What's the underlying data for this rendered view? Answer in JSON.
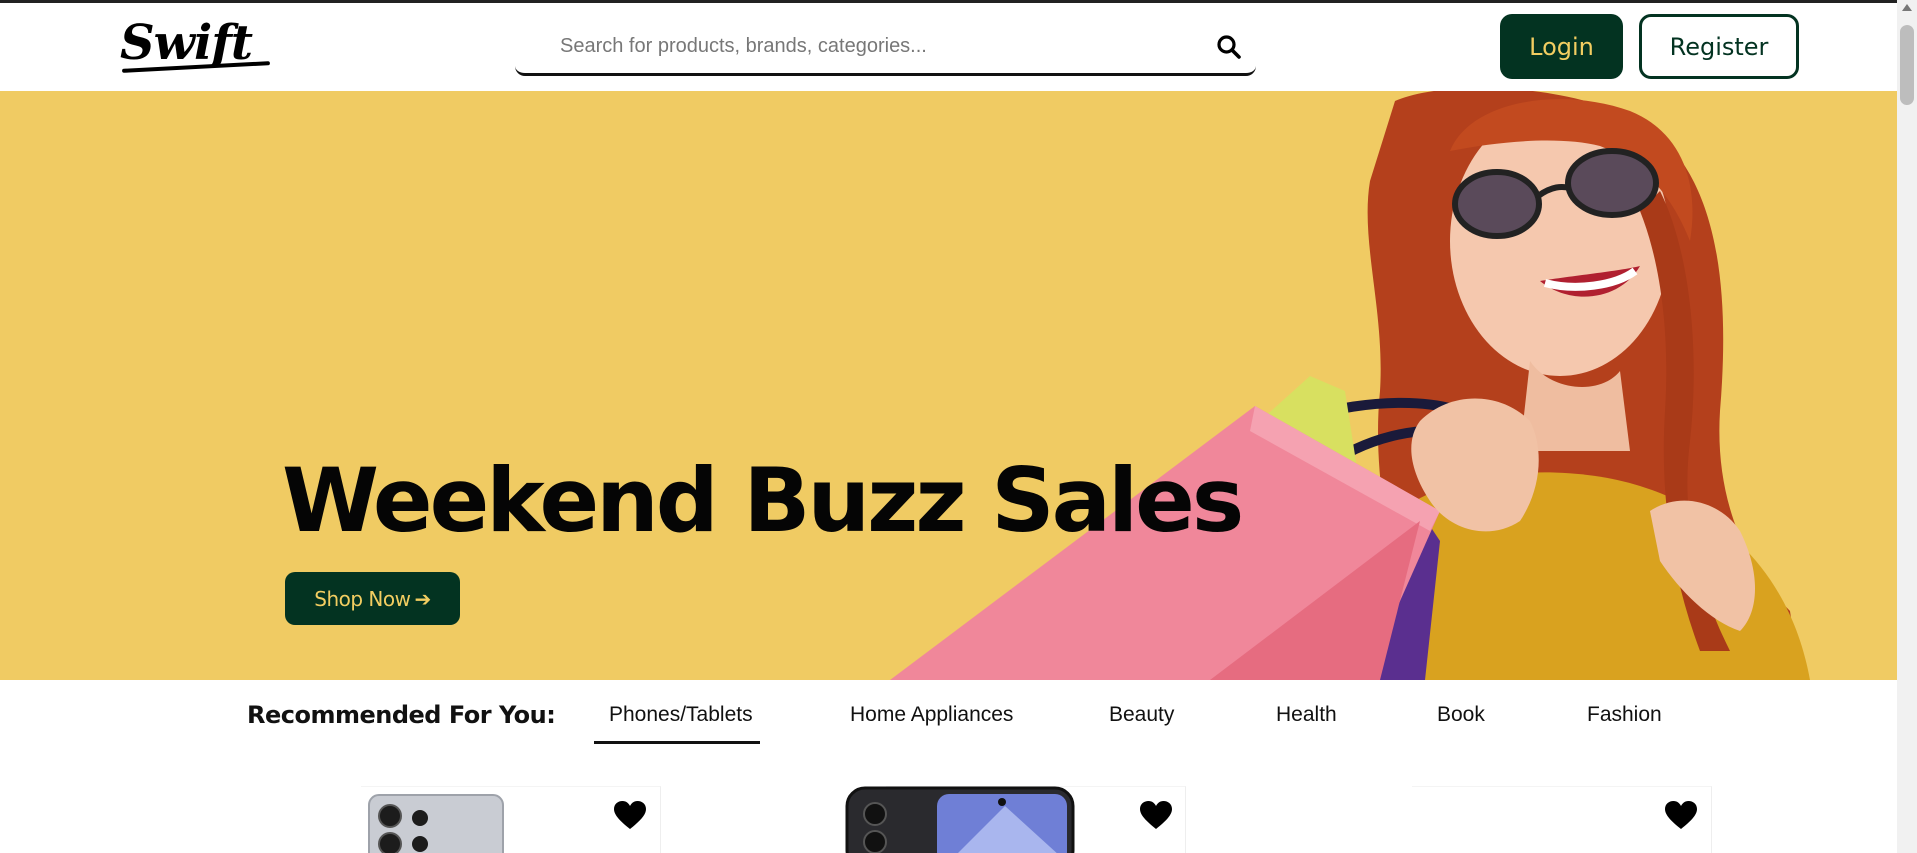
{
  "brand": {
    "logo_text": "Swift"
  },
  "search": {
    "placeholder": "Search for products, brands, categories..."
  },
  "auth": {
    "login_label": "Login",
    "register_label": "Register"
  },
  "hero": {
    "title": "Weekend Buzz Sales",
    "cta_label": "Shop Now",
    "cta_icon": "arrow-right-icon",
    "background_color": "#f0cb63"
  },
  "recommended": {
    "heading": "Recommended For You:",
    "tabs": [
      {
        "label": "Phones/Tablets",
        "active": true
      },
      {
        "label": "Home Appliances",
        "active": false
      },
      {
        "label": "Beauty",
        "active": false
      },
      {
        "label": "Health",
        "active": false
      },
      {
        "label": "Book",
        "active": false
      },
      {
        "label": "Fashion",
        "active": false
      }
    ]
  },
  "products": [
    {
      "image": "silver-phone",
      "wishlist_icon": "heart-icon"
    },
    {
      "image": "dark-phone",
      "wishlist_icon": "heart-icon"
    },
    {
      "image": "",
      "wishlist_icon": "heart-icon"
    }
  ],
  "colors": {
    "primary": "#033321",
    "accent": "#f2cd61",
    "hero_bg": "#f0cb63"
  }
}
